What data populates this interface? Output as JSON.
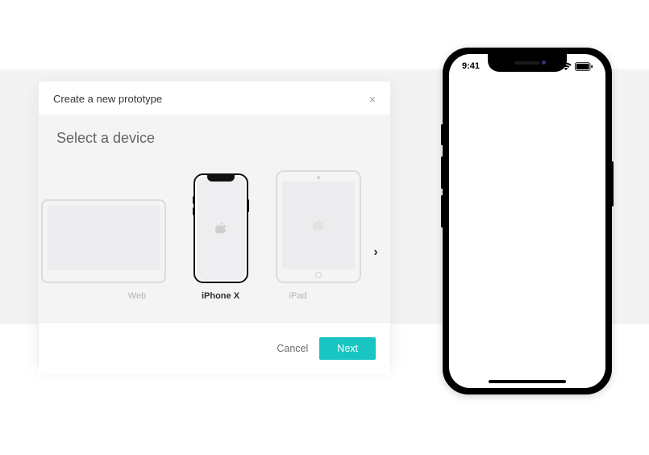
{
  "modal": {
    "title": "Create a new prototype",
    "subtitle": "Select a device",
    "cancel_label": "Cancel",
    "next_label": "Next",
    "devices": {
      "web": {
        "label": "Web",
        "selected": false
      },
      "iphonex": {
        "label": "iPhone X",
        "selected": true
      },
      "ipad": {
        "label": "iPad",
        "selected": false
      }
    }
  },
  "preview": {
    "clock": "9:41"
  }
}
